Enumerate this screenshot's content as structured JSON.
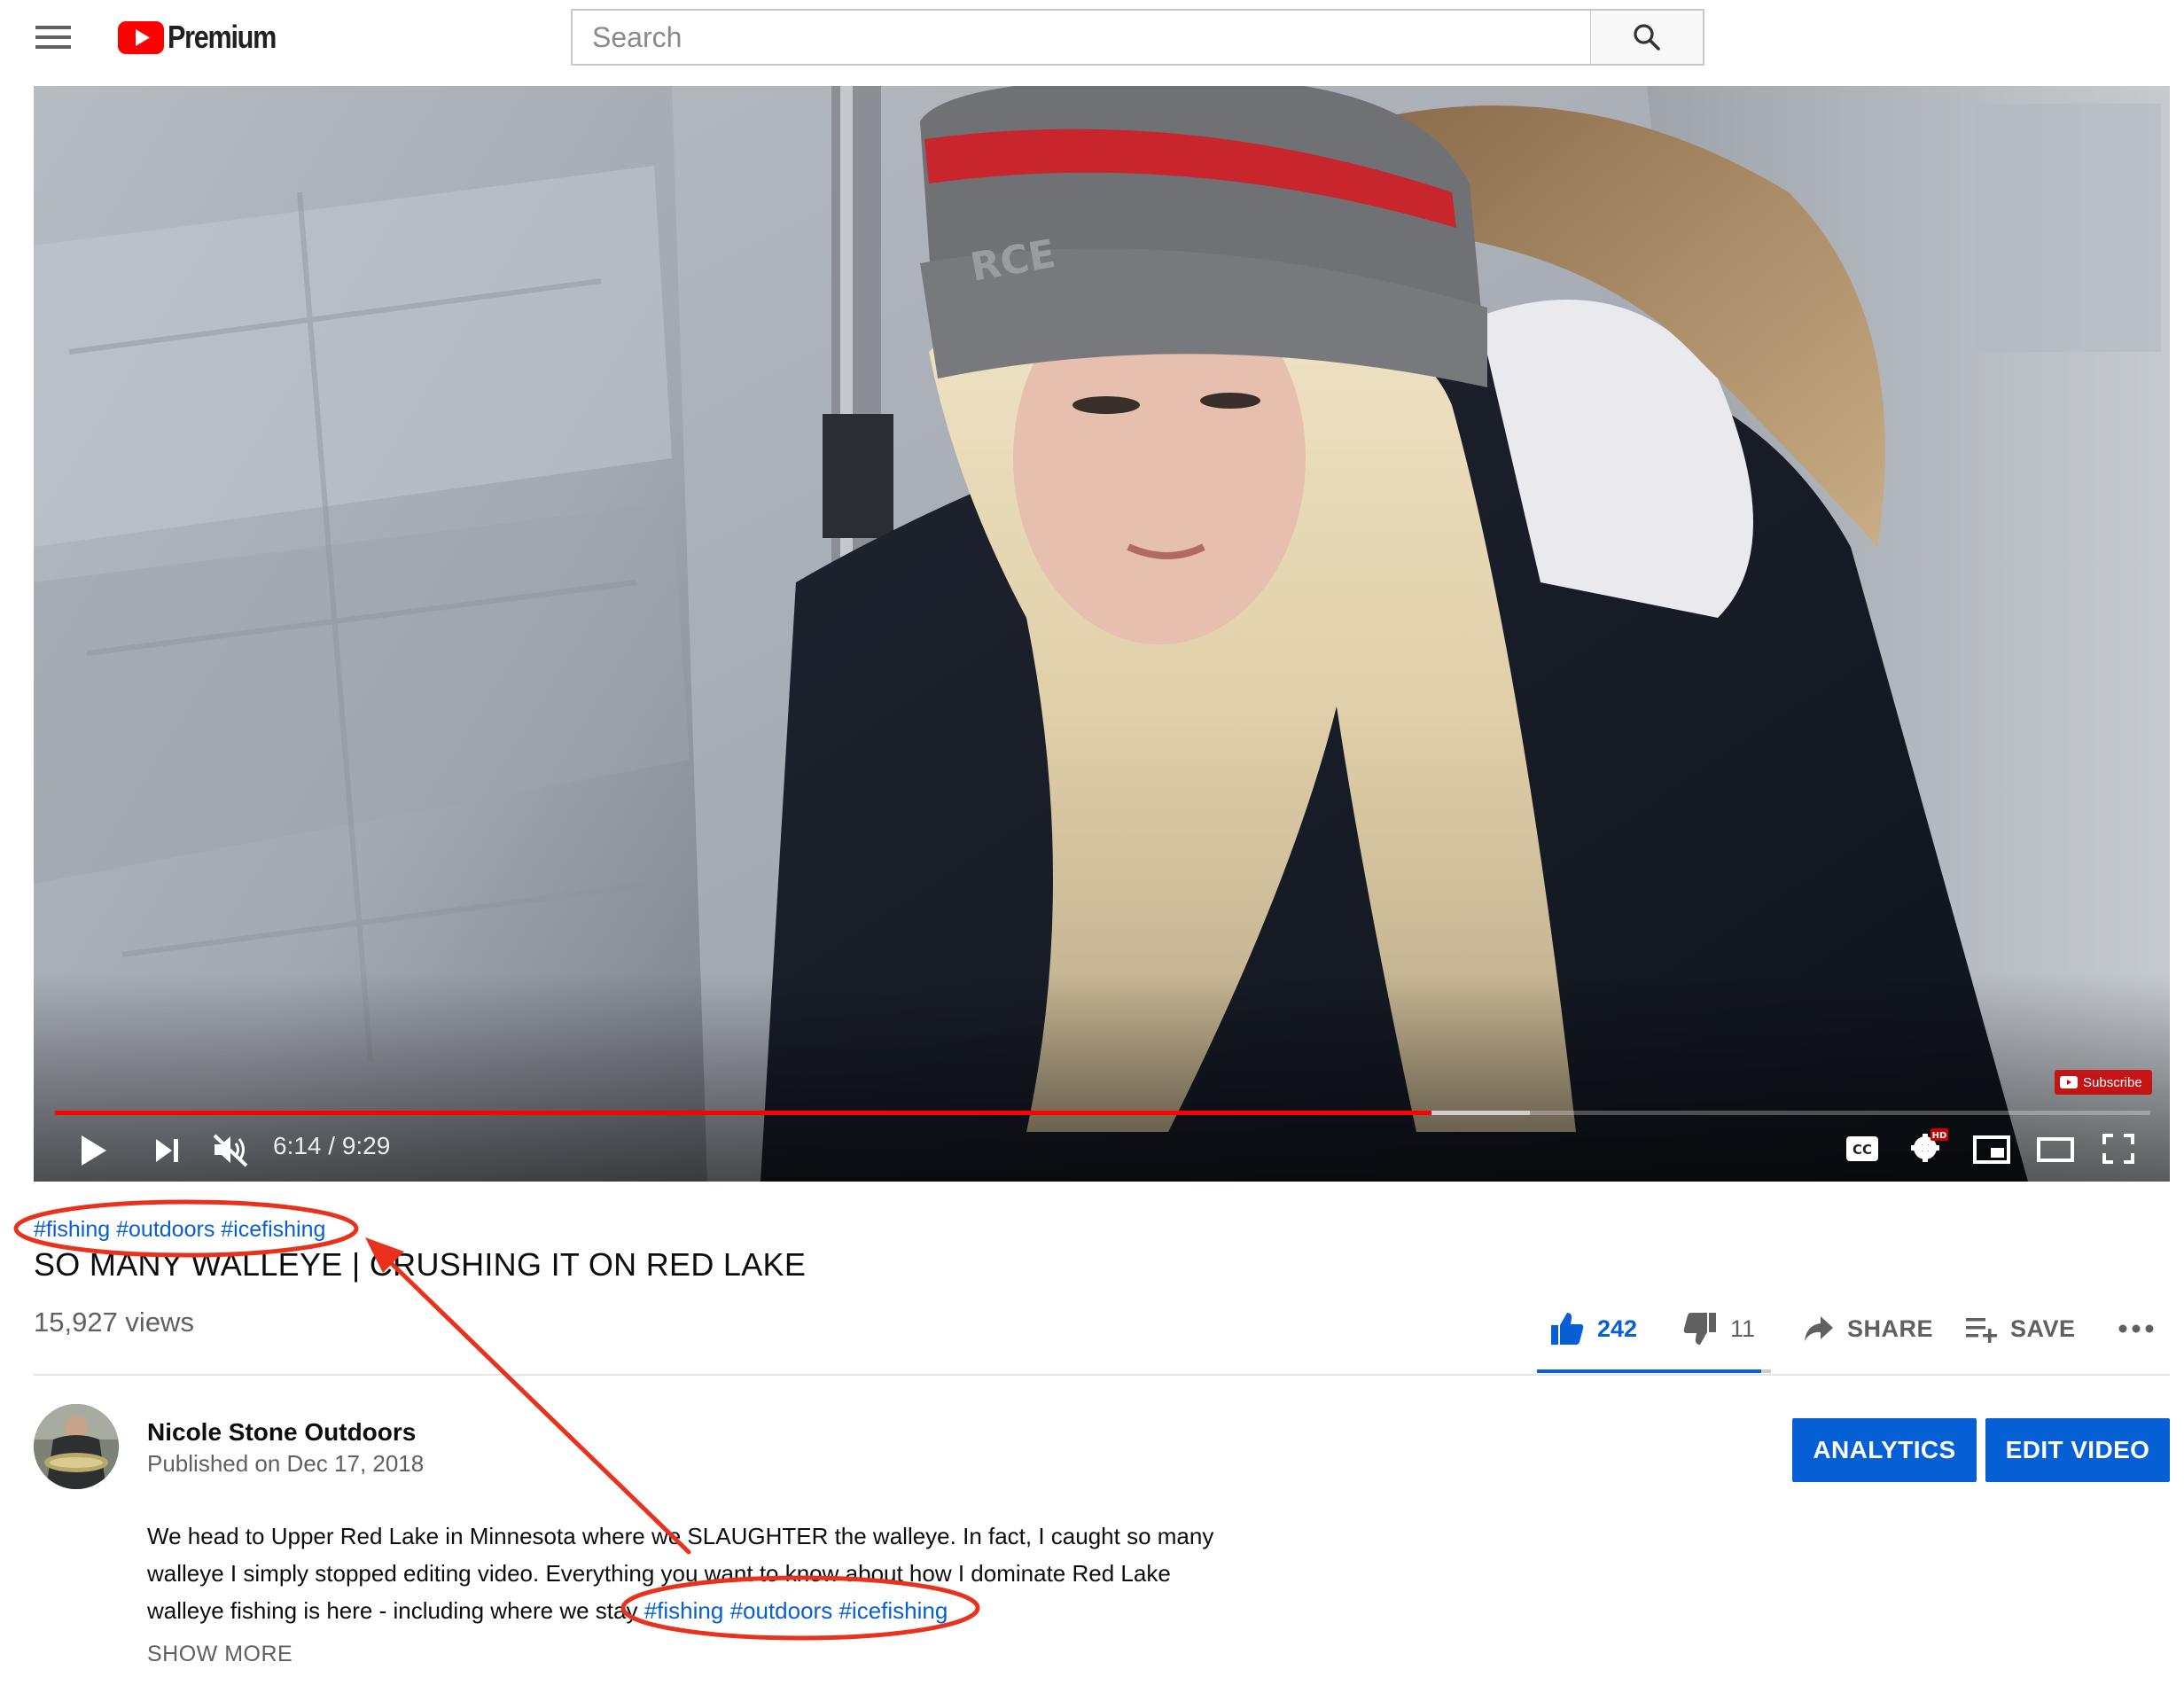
{
  "header": {
    "brand": "Premium",
    "search_placeholder": "Search"
  },
  "player": {
    "time_display": "6:14 / 9:29",
    "played_fraction": 0.657,
    "buffered_fraction": 0.704,
    "subscribe_watermark": "Subscribe",
    "icons": [
      "play-icon",
      "next-icon",
      "mute-icon",
      "captions-icon",
      "settings-hd-icon",
      "miniplayer-icon",
      "theater-icon",
      "fullscreen-icon"
    ]
  },
  "video": {
    "hashtags": [
      "#fishing",
      "#outdoors",
      "#icefishing"
    ],
    "title": "SO MANY WALLEYE | CRUSHING IT ON RED LAKE",
    "views": "15,927 views"
  },
  "actions": {
    "likes": "242",
    "dislikes": "11",
    "like_fraction": 0.957,
    "share_label": "SHARE",
    "save_label": "SAVE"
  },
  "channel": {
    "name": "Nicole Stone Outdoors",
    "published": "Published on Dec 17, 2018",
    "analytics_label": "ANALYTICS",
    "edit_label": "EDIT VIDEO"
  },
  "description": {
    "line1": "We head to Upper Red Lake in Minnesota where we SLAUGHTER the walleye.  In fact, I caught so many",
    "line2": "walleye I simply stopped editing video.  Everything you want to know about how I dominate Red Lake",
    "line3": "walleye fishing is here - including where we stay ",
    "tags": [
      "#fishing",
      "#outdoors",
      "#icefishing"
    ],
    "show_more": "SHOW MORE"
  },
  "colors": {
    "brand_red": "#ff0000",
    "link_blue": "#065fd4",
    "annotation_red": "#e8321e"
  }
}
